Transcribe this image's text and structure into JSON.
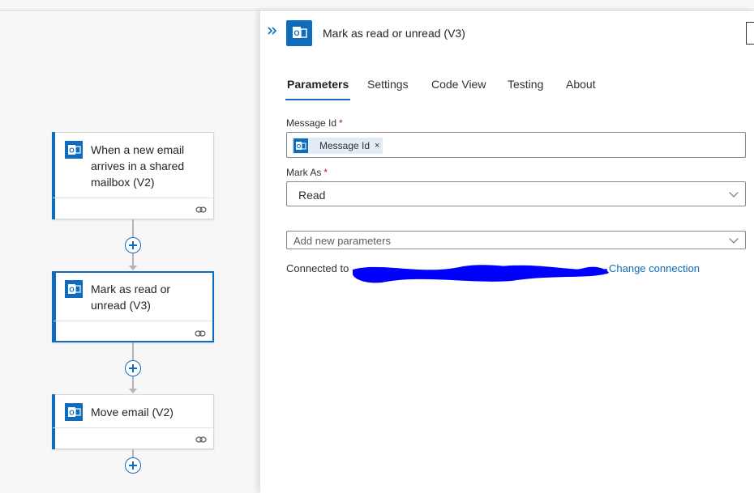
{
  "canvas": {
    "cards": [
      {
        "title": "When a new email arrives in a shared mailbox (V2)",
        "icon": "outlook-icon",
        "selected": false
      },
      {
        "title": "Mark as read or unread (V3)",
        "icon": "outlook-icon",
        "selected": true
      },
      {
        "title": "Move email (V2)",
        "icon": "outlook-icon",
        "selected": false
      }
    ]
  },
  "panel": {
    "title": "Mark as read or unread (V3)",
    "collapse_icon": "double-chevron-right-icon",
    "tabs": [
      "Parameters",
      "Settings",
      "Code View",
      "Testing",
      "About"
    ],
    "active_tab": "Parameters",
    "fields": {
      "message_id_label": "Message Id",
      "message_id_required": "*",
      "message_id_token": "Message Id",
      "message_id_token_remove": "×",
      "mark_as_label": "Mark As",
      "mark_as_required": "*",
      "mark_as_value": "Read",
      "add_params_placeholder": "Add new parameters"
    },
    "connection": {
      "prefix": "Connected to",
      "change_link": "Change connection"
    }
  },
  "colors": {
    "accent": "#0f6cbd",
    "redaction": "#0000ff"
  }
}
